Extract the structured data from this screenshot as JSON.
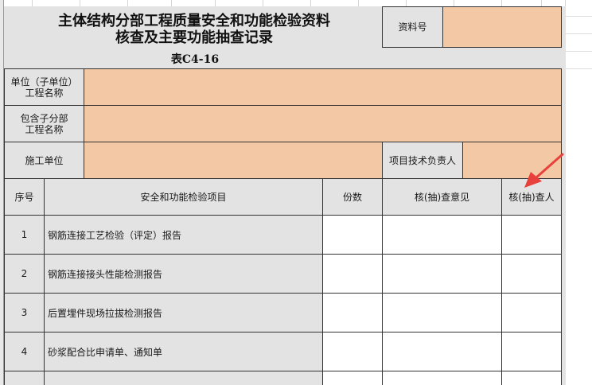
{
  "title": {
    "line1": "主体结构分部工程质量安全和功能检验资料",
    "line2": "核查及主要功能抽查记录",
    "form_code": "表C4-16"
  },
  "doc_no": {
    "label": "资料号",
    "value": ""
  },
  "info": {
    "unit_label": "单位（子单位）\n工程名称",
    "unit_value": "",
    "subunit_label": "包含子分部\n工程名称",
    "subunit_value": "",
    "contractor_label": "施工单位",
    "contractor_value": "",
    "tech_lead_label": "项目技术负责人",
    "tech_lead_value": ""
  },
  "table": {
    "headers": {
      "seq": "序号",
      "item": "安全和功能检验项目",
      "copies": "份数",
      "opinion": "核(抽)查意见",
      "checker": "核(抽)查人"
    },
    "rows": [
      {
        "seq": "1",
        "item": "钢筋连接工艺检验（评定）报告"
      },
      {
        "seq": "2",
        "item": "钢筋连接接头性能检测报告"
      },
      {
        "seq": "3",
        "item": "后置埋件现场拉拔检测报告"
      },
      {
        "seq": "4",
        "item": "砂浆配合比申请单、通知单"
      },
      {
        "seq": "",
        "item": ""
      }
    ]
  },
  "colors": {
    "peach_fill": "#f2c9a4",
    "sheet_gray": "#e3e3e3",
    "arrow_red": "#e8413c"
  },
  "icons": [
    "red-annotation-arrow-icon"
  ]
}
